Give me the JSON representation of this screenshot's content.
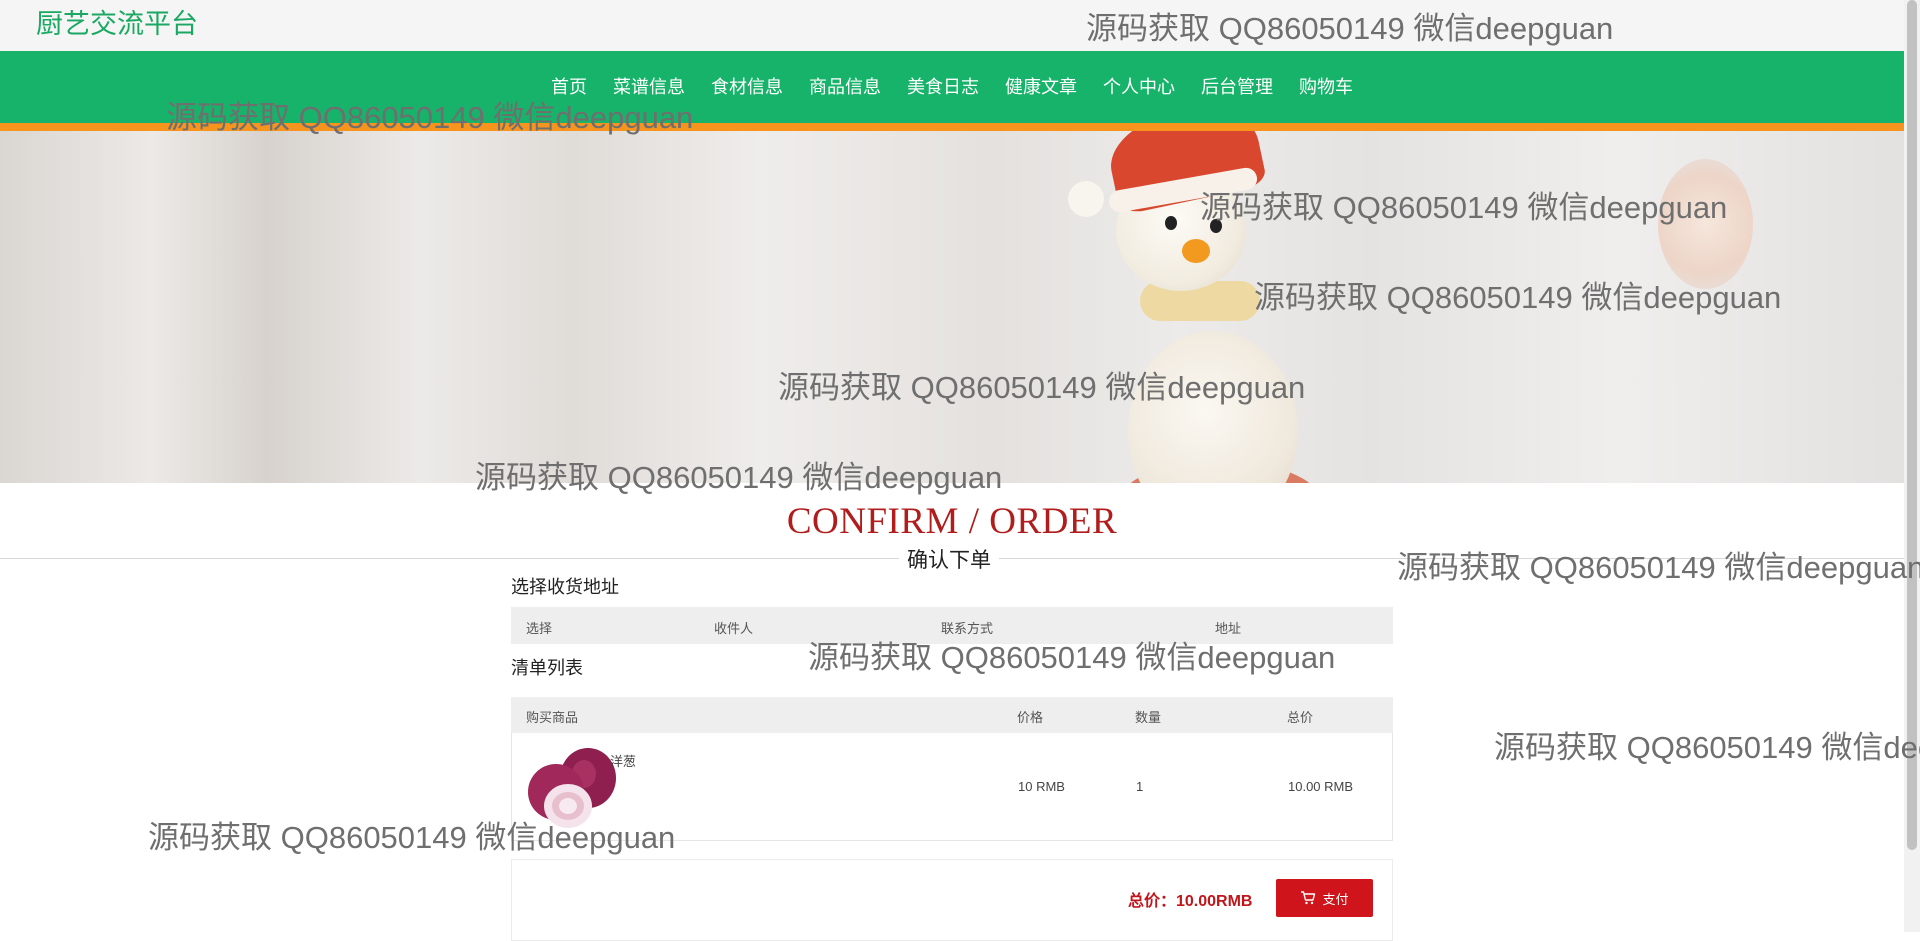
{
  "header": {
    "brand": "厨艺交流平台"
  },
  "nav": {
    "items": [
      "首页",
      "菜谱信息",
      "食材信息",
      "商品信息",
      "美食日志",
      "健康文章",
      "个人中心",
      "后台管理",
      "购物车"
    ]
  },
  "section": {
    "title": "CONFIRM / ORDER",
    "subtitle": "确认下单"
  },
  "address": {
    "label": "选择收货地址",
    "columns": [
      "选择",
      "收件人",
      "联系方式",
      "地址"
    ]
  },
  "list": {
    "label": "清单列表",
    "columns": [
      "购买商品",
      "价格",
      "数量",
      "总价"
    ],
    "rows": [
      {
        "name": "洋葱",
        "price": "10 RMB",
        "qty": "1",
        "total": "10.00 RMB",
        "image": "onion-image"
      }
    ]
  },
  "summary": {
    "total": "总价：10.00RMB",
    "pay_label": "支付",
    "pay_icon": "cart-icon"
  },
  "watermark": {
    "text": "源码获取 QQ86050149 微信deepguan"
  },
  "colors": {
    "brand": "#1aa862",
    "nav_bg": "#17b36a",
    "nav_line": "#f7941d",
    "accent": "#b11c1c",
    "pay": "#d0141b"
  }
}
